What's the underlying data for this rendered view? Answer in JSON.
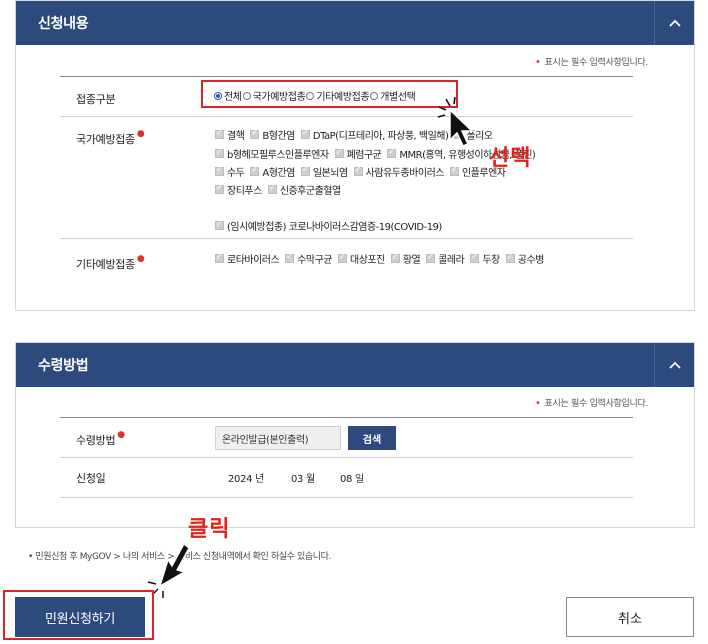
{
  "apply_panel": {
    "title": "신청내용",
    "required_note": "표시는 필수 입력사항입니다.",
    "vaccination_type_label": "접종구분",
    "radio_options": [
      {
        "label": "전체",
        "selected": true
      },
      {
        "label": "국가예방접종",
        "selected": false
      },
      {
        "label": "기타예방접종",
        "selected": false
      },
      {
        "label": "개별선택",
        "selected": false
      }
    ],
    "national_label": "국가예방접종",
    "national_rows": [
      [
        "결핵",
        "B형간염",
        "DTaP(디프테리아, 파상풍, 백일해)",
        "폴리오"
      ],
      [
        "b형헤모필루스인플루엔자",
        "폐렴구균",
        "MMR(홍역, 유행성이하선염, 풍진)"
      ],
      [
        "수두",
        "A형간염",
        "일본뇌염",
        "사람유두종바이러스",
        "인플루엔자"
      ],
      [
        "장티푸스",
        "신증후군출혈열"
      ],
      [
        "(임시예방접종) 코로나바이러스감염증-19(COVID-19)"
      ]
    ],
    "other_label": "기타예방접종",
    "other_items": [
      "로타바이러스",
      "수막구균",
      "대상포진",
      "황열",
      "콜레라",
      "두창",
      "공수병"
    ]
  },
  "receive_panel": {
    "title": "수령방법",
    "required_note": "표시는 필수 입력사항입니다.",
    "method_label": "수령방법",
    "method_value": "온라인발급(본인출력)",
    "search_label": "검색",
    "date_label": "신청일",
    "year": "2024 년",
    "month": "03 월",
    "day": "08 일"
  },
  "notice": "• 민원신청 후 MyGOV > 나의 서비스 > 서비스 신청내역에서 확인 하실수 있습니다.",
  "buttons": {
    "submit": "민원신청하기",
    "cancel": "취소"
  },
  "annotations": {
    "select": "선택",
    "click": "클릭",
    "color": "#e2231a"
  },
  "colors": {
    "header": "#2d4a7d",
    "required": "#e0302f"
  }
}
